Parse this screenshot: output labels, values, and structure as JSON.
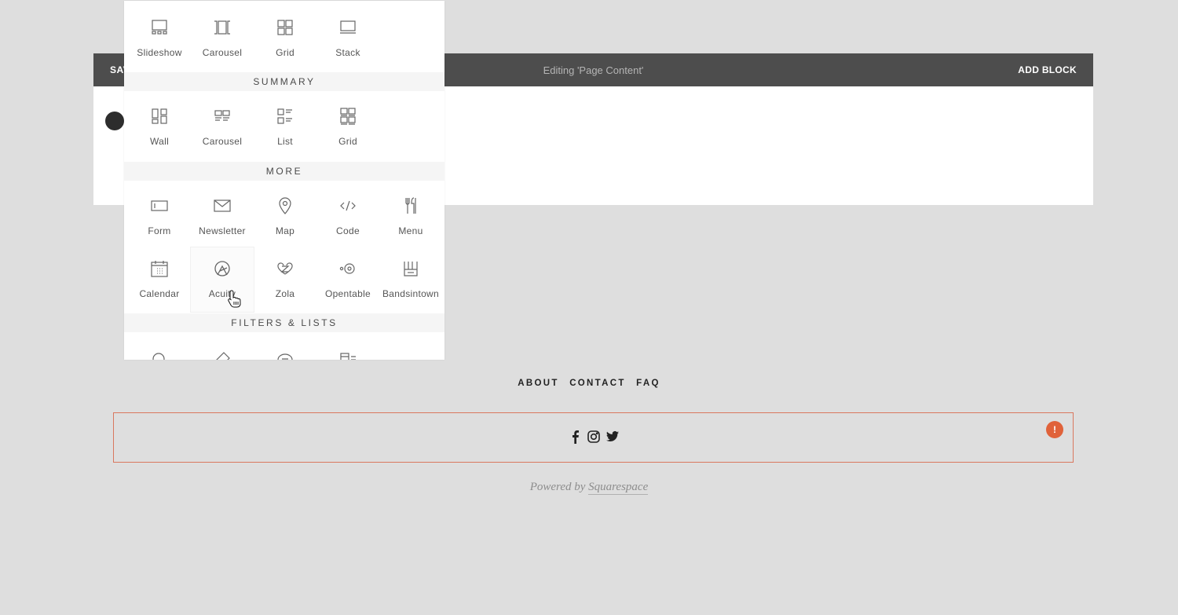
{
  "editor_bar": {
    "save_label": "SAVE",
    "title": "Editing 'Page Content'",
    "add_block_label": "ADD BLOCK"
  },
  "picker": {
    "gallery_items": [
      {
        "label": "Slideshow",
        "icon": "slideshow-icon"
      },
      {
        "label": "Carousel",
        "icon": "carousel-icon"
      },
      {
        "label": "Grid",
        "icon": "grid-icon"
      },
      {
        "label": "Stack",
        "icon": "stack-icon"
      }
    ],
    "summary_header": "SUMMARY",
    "summary_items": [
      {
        "label": "Wall",
        "icon": "wall-icon"
      },
      {
        "label": "Carousel",
        "icon": "summary-carousel-icon"
      },
      {
        "label": "List",
        "icon": "list-icon"
      },
      {
        "label": "Grid",
        "icon": "summary-grid-icon"
      }
    ],
    "more_header": "MORE",
    "more_items": [
      {
        "label": "Form",
        "icon": "form-icon"
      },
      {
        "label": "Newsletter",
        "icon": "envelope-icon"
      },
      {
        "label": "Map",
        "icon": "map-pin-icon"
      },
      {
        "label": "Code",
        "icon": "code-icon"
      },
      {
        "label": "Menu",
        "icon": "fork-knife-icon"
      },
      {
        "label": "Calendar",
        "icon": "calendar-icon"
      },
      {
        "label": "Acuity",
        "icon": "acuity-icon"
      },
      {
        "label": "Zola",
        "icon": "zola-icon"
      },
      {
        "label": "Opentable",
        "icon": "opentable-icon"
      },
      {
        "label": "Bandsintown",
        "icon": "bandsintown-icon"
      }
    ],
    "filters_header": "FILTERS & LISTS"
  },
  "footer": {
    "nav": [
      "ABOUT",
      "CONTACT",
      "FAQ"
    ],
    "social": [
      "facebook-icon",
      "instagram-icon",
      "twitter-icon"
    ],
    "alert": "!",
    "powered_prefix": "Powered by",
    "powered_link": "Squarespace"
  },
  "colors": {
    "editor_bar": "#4d4d4d",
    "alert": "#e0623a",
    "social_border": "#d9775e"
  }
}
